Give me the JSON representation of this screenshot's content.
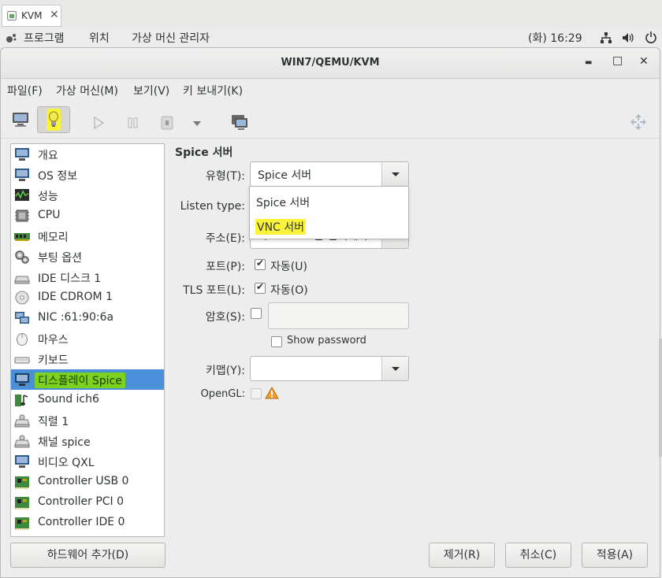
{
  "browser_tab": {
    "title": "KVM",
    "close": "✕"
  },
  "panel": {
    "apps": "프로그램",
    "places": "위치",
    "vm_manager": "가상 머신 관리자",
    "clock": "(화) 16:29"
  },
  "window": {
    "title": "WIN7/QEMU/KVM",
    "minimize": "▬",
    "maximize": "□",
    "close": "✕"
  },
  "menu": {
    "file": "파일(F)",
    "vm": "가상 머신(M)",
    "view": "보기(V)",
    "sendkey": "키 보내기(K)"
  },
  "hardware": [
    {
      "label": "개요",
      "icon": "monitor-icon"
    },
    {
      "label": "OS 정보",
      "icon": "monitor-icon"
    },
    {
      "label": "성능",
      "icon": "performance-graph-icon"
    },
    {
      "label": "CPU",
      "icon": "cpu-chip-icon"
    },
    {
      "label": "메모리",
      "icon": "memory-module-icon"
    },
    {
      "label": "부팅 옵션",
      "icon": "gears-icon"
    },
    {
      "label": "IDE 디스크 1",
      "icon": "hard-disk-icon"
    },
    {
      "label": "IDE CDROM 1",
      "icon": "cdrom-icon"
    },
    {
      "label": "NIC :61:90:6a",
      "icon": "network-card-icon"
    },
    {
      "label": "마우스",
      "icon": "mouse-icon"
    },
    {
      "label": "키보드",
      "icon": "keyboard-icon"
    },
    {
      "label": "디스플레이 Spice",
      "icon": "monitor-icon",
      "selected": true
    },
    {
      "label": "Sound ich6",
      "icon": "sound-card-icon"
    },
    {
      "label": "직렬 1",
      "icon": "serial-port-icon"
    },
    {
      "label": "채널 spice",
      "icon": "channel-icon"
    },
    {
      "label": "비디오 QXL",
      "icon": "monitor-icon"
    },
    {
      "label": "Controller USB 0",
      "icon": "controller-card-icon"
    },
    {
      "label": "Controller PCI 0",
      "icon": "controller-card-icon"
    },
    {
      "label": "Controller IDE 0",
      "icon": "controller-card-icon"
    }
  ],
  "form": {
    "section_title": "Spice 서버",
    "type_label": "유형(T):",
    "type_value": "Spice 서버",
    "listen_label": "Listen type:",
    "address_label": "주소(E):",
    "address_partial_1": "가",
    "address_partial_2": "든 인터페이스",
    "port_label": "포트(P):",
    "port_auto": "자동(U)",
    "tls_label": "TLS 포트(L):",
    "tls_auto": "자동(O)",
    "password_label": "암호(S):",
    "show_password": "Show password",
    "keymap_label": "키맵(Y):",
    "opengl_label": "OpenGL:"
  },
  "dropdown_options": [
    "Spice 서버",
    "VNC 서버"
  ],
  "buttons": {
    "add_hardware": "하드웨어 추가(D)",
    "remove": "제거(R)",
    "cancel": "취소(C)",
    "apply": "적용(A)"
  },
  "colors": {
    "selection": "#4a90d9",
    "highlight_yellow": "#fbf33a",
    "highlight_green": "#7cd21e"
  }
}
